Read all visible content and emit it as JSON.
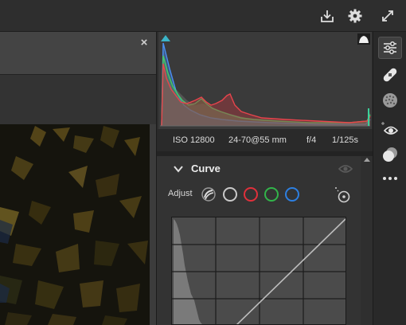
{
  "toolbar": {
    "icons": [
      "export-icon",
      "gear-icon",
      "expand-icon"
    ]
  },
  "document": {
    "close_label": "×"
  },
  "exif": {
    "iso": "ISO 12800",
    "lens": "24-70@55 mm",
    "aperture": "f/4",
    "shutter": "1/125s"
  },
  "curve_panel": {
    "title": "Curve",
    "adjust_label": "Adjust",
    "channels": [
      {
        "name": "rgb",
        "color": "#c9c9c9"
      },
      {
        "name": "red",
        "color": "#e0303b"
      },
      {
        "name": "green",
        "color": "#32b44a"
      },
      {
        "name": "blue",
        "color": "#2d7fe0"
      }
    ]
  },
  "colors": {
    "accent": "#3bb4c8",
    "histogram_red": "#e0404a",
    "histogram_green": "#3fc060",
    "histogram_blue": "#3a80e8"
  },
  "side_tools": [
    "adjustments-sliders-icon",
    "healing-bandage-icon",
    "texture-dots-icon",
    "red-eye-icon",
    "overlay-circles-icon",
    "more-icon"
  ]
}
